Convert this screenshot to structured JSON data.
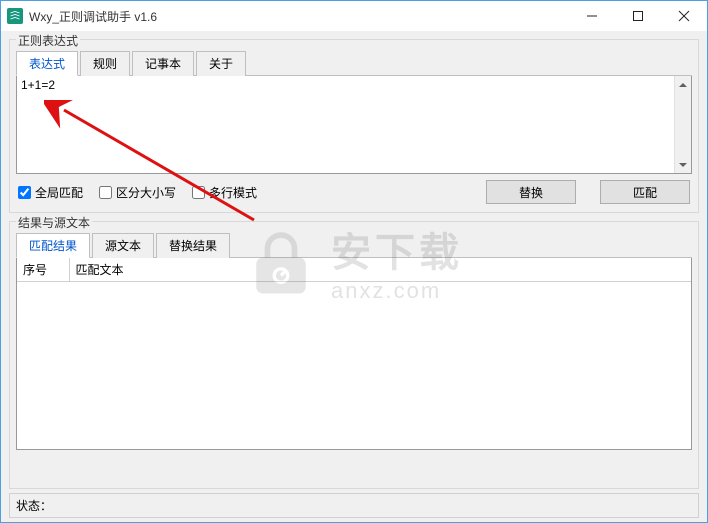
{
  "window": {
    "title": "Wxy_正则调试助手  v1.6"
  },
  "groups": {
    "regex": "正则表达式",
    "result": "结果与源文本"
  },
  "tabs_top": [
    {
      "label": "表达式",
      "active": true
    },
    {
      "label": "规则",
      "active": false
    },
    {
      "label": "记事本",
      "active": false
    },
    {
      "label": "关于",
      "active": false
    }
  ],
  "editor": {
    "value": "1+1=2"
  },
  "options": {
    "global": {
      "label": "全局匹配",
      "checked": true
    },
    "case": {
      "label": "区分大小写",
      "checked": false
    },
    "multiline": {
      "label": "多行模式",
      "checked": false
    }
  },
  "buttons": {
    "replace": "替换",
    "match": "匹配"
  },
  "tabs_bottom": [
    {
      "label": "匹配结果",
      "active": true
    },
    {
      "label": "源文本",
      "active": false
    },
    {
      "label": "替换结果",
      "active": false
    }
  ],
  "table": {
    "col_index": "序号",
    "col_text": "匹配文本"
  },
  "status": {
    "label": "状态："
  },
  "watermark": {
    "big": "安下载",
    "small": "anxz.com"
  }
}
